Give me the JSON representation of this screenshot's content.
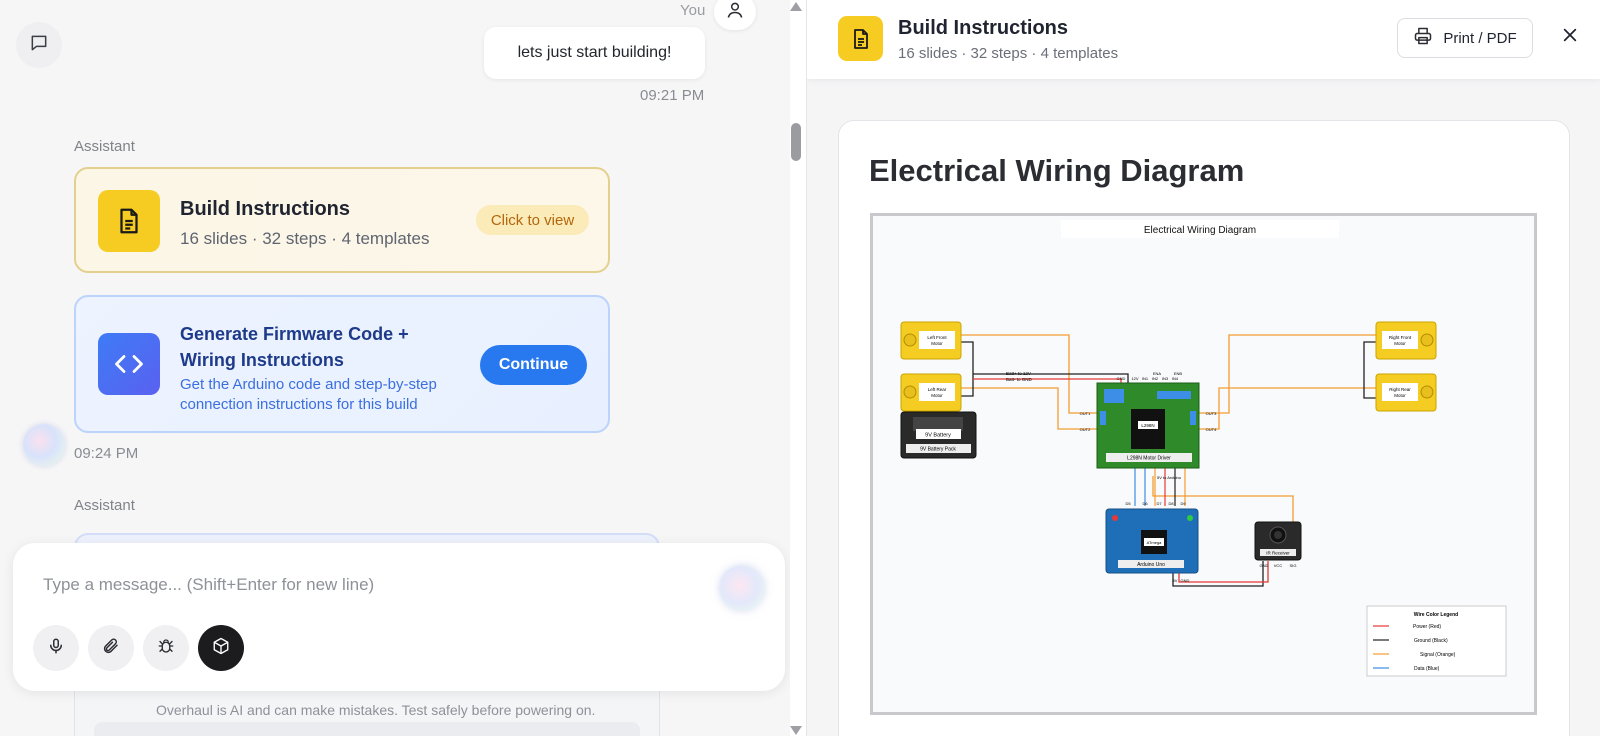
{
  "chat": {
    "you_label": "You",
    "user_message": "lets just start building!",
    "user_time": "09:21 PM",
    "assistant_label_1": "Assistant",
    "build_card": {
      "title": "Build Instructions",
      "subtitle": "16 slides · 32 steps · 4 templates",
      "badge": "Click to view"
    },
    "firmware_card": {
      "title": "Generate Firmware Code + Wiring Instructions",
      "description": "Get the Arduino code and step-by-step connection instructions for this build",
      "button": "Continue"
    },
    "assistant_time": "09:24 PM",
    "assistant_label_2": "Assistant"
  },
  "composer": {
    "placeholder": "Type a message... (Shift+Enter for new line)",
    "tools": [
      "microphone-icon",
      "paperclip-icon",
      "bug-icon",
      "cube-icon"
    ]
  },
  "disclaimer": "Overhaul is AI and can make mistakes. Test safely before powering on.",
  "panel": {
    "title": "Build Instructions",
    "subtitle": "16 slides · 32 steps · 4 templates",
    "print_label": "Print / PDF",
    "slide_title": "Electrical Wiring Diagram"
  },
  "diagram": {
    "title": "Electrical Wiring Diagram",
    "motors": {
      "left_front": [
        "Left Front",
        "Motor"
      ],
      "left_rear": [
        "Left Rear",
        "Motor"
      ],
      "right_front": [
        "Right Front",
        "Motor"
      ],
      "right_rear": [
        "Right Rear",
        "Motor"
      ]
    },
    "battery": {
      "label": "9V Battery",
      "pack": "9V Battery Pack"
    },
    "driver": {
      "label": "L298N Motor Driver",
      "chip": "L298N",
      "pins_top": [
        "ENA",
        "ENB",
        "IN1",
        "IN2",
        "IN3",
        "IN4"
      ],
      "pins_mid": "12V",
      "pins_5v": "5V",
      "pins_gnd": "GND",
      "to_arduino": "5V to Arduino",
      "outs": [
        "OUT1",
        "OUT2",
        "OUT3",
        "OUT4"
      ]
    },
    "notes": [
      "Batt+ to 12V",
      "Batt- to GND"
    ],
    "arduino": {
      "label": "Arduino Uno",
      "chip": "ATmega",
      "pins": [
        "D5",
        "D6",
        "D7",
        "D8",
        "D9"
      ],
      "bottom": [
        "5V",
        "GND"
      ]
    },
    "receiver": {
      "label": "IR Receiver",
      "pins": [
        "GND",
        "VCC",
        "SIG"
      ]
    },
    "legend": {
      "title": "Wire Color Legend",
      "items": [
        {
          "label": "Power (Red)",
          "color": "#e53935"
        },
        {
          "label": "Ground (Black)",
          "color": "#222222"
        },
        {
          "label": "Signal (Orange)",
          "color": "#f39c33"
        },
        {
          "label": "Data (Blue)",
          "color": "#3d8ee6"
        }
      ]
    }
  },
  "colors": {
    "accent_yellow": "#f7cc22",
    "accent_blue": "#2878f0",
    "badge_text": "#b4660c"
  }
}
